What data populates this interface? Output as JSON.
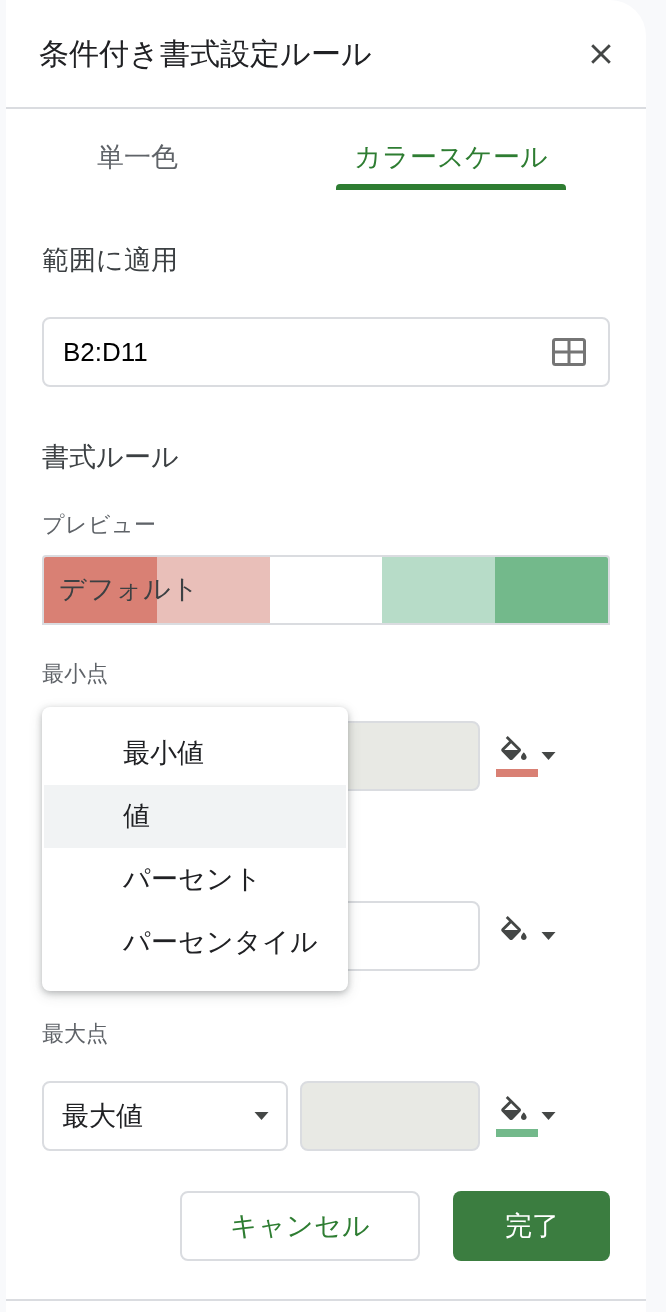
{
  "dialog": {
    "title": "条件付き書式設定ルール"
  },
  "tabs": [
    {
      "label": "単一色",
      "selected": false
    },
    {
      "label": "カラースケール",
      "selected": true
    }
  ],
  "range": {
    "label": "範囲に適用",
    "value": "B2:D11"
  },
  "rules": {
    "heading": "書式ルール",
    "preview_label": "プレビュー",
    "preview": {
      "text": "デフォルト",
      "segments": [
        {
          "kind": "fill",
          "color": "#d98074"
        },
        {
          "kind": "fill",
          "color": "#e9bfb9"
        },
        {
          "kind": "blank"
        },
        {
          "kind": "fill",
          "color": "#b7dcc8"
        },
        {
          "kind": "fill",
          "color": "#73b98b"
        }
      ]
    }
  },
  "points": [
    {
      "label": "最小点",
      "value_field": {
        "disabled": true
      },
      "color": "#d98074"
    },
    {
      "value_field": {
        "disabled": false
      }
    },
    {
      "label": "最大点",
      "type": "最大値",
      "value_field": {
        "disabled": true
      },
      "color": "#73b98b"
    }
  ],
  "type_menu": {
    "items": [
      {
        "label": "最小値",
        "selected": false
      },
      {
        "label": "値",
        "selected": true
      },
      {
        "label": "パーセント",
        "selected": false
      },
      {
        "label": "パーセンタイル",
        "selected": false
      }
    ]
  },
  "buttons": [
    {
      "label": "キャンセル",
      "kind": "secondary"
    },
    {
      "label": "完了",
      "kind": "primary"
    }
  ]
}
